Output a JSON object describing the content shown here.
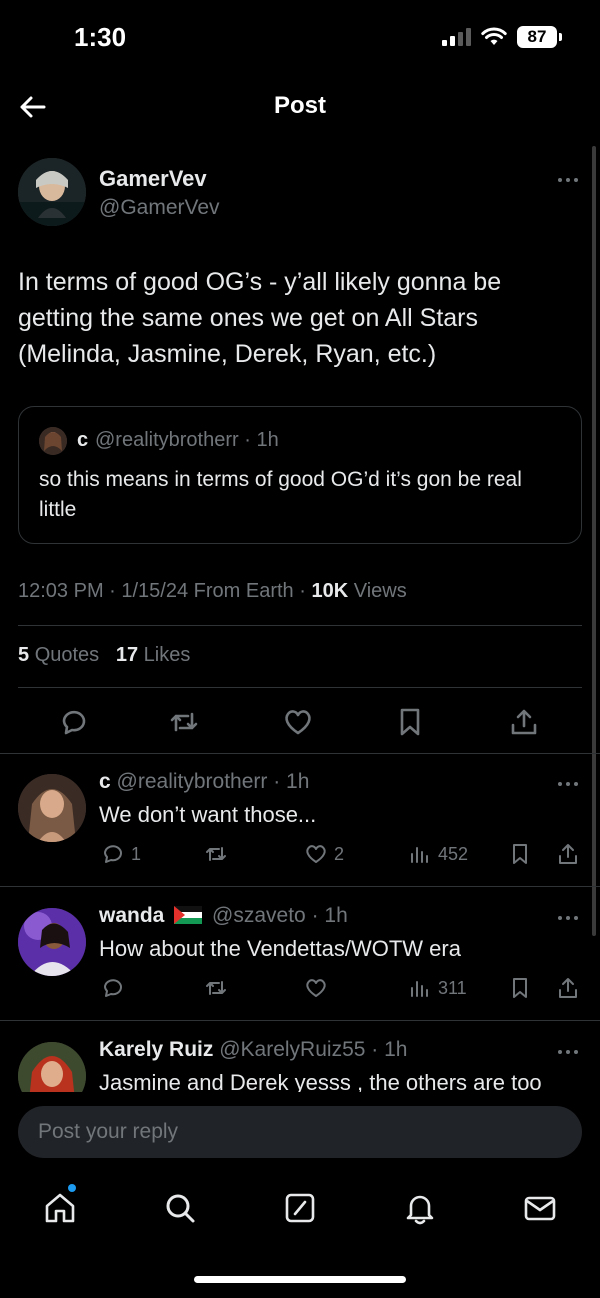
{
  "status_bar": {
    "time": "1:30",
    "battery": "87"
  },
  "header": {
    "title": "Post"
  },
  "post": {
    "name": "GamerVev",
    "handle": "@GamerVev",
    "text": "In terms of good OG’s - y’all likely gonna be getting the same ones we get on All Stars (Melinda, Jasmine, Derek, Ryan, etc.)",
    "quote": {
      "name": "c",
      "handle": "@realitybrotherr · 1h",
      "text": "so this means in terms of good OG’d it’s gon be real little"
    },
    "meta": {
      "time_date": "12:03 PM · 1/15/24 From Earth ·",
      "views_count": "10K",
      "views_label": "Views"
    },
    "stats": {
      "quotes_count": "5",
      "quotes_label": "Quotes",
      "likes_count": "17",
      "likes_label": "Likes"
    }
  },
  "replies": [
    {
      "name": "c",
      "handle": "@realitybrotherr · 1h",
      "text": "We don’t want those...",
      "replies_count": "1",
      "likes_count": "2",
      "views_count": "452"
    },
    {
      "name": "wanda",
      "flag": "palestine-flag",
      "handle": "@szaveto · 1h",
      "text": "How about the Vendettas/WOTW era",
      "views_count": "311"
    },
    {
      "name": "Karely Ruiz",
      "handle": "@KarelyRuiz55 · 1h",
      "text": "Jasmine and Derek yesss , the others are too"
    }
  ],
  "composer": {
    "placeholder": "Post your reply"
  },
  "colors": {
    "accent": "#1d9bf0",
    "background": "#000000",
    "muted": "#71767b",
    "border": "#2f3336"
  }
}
